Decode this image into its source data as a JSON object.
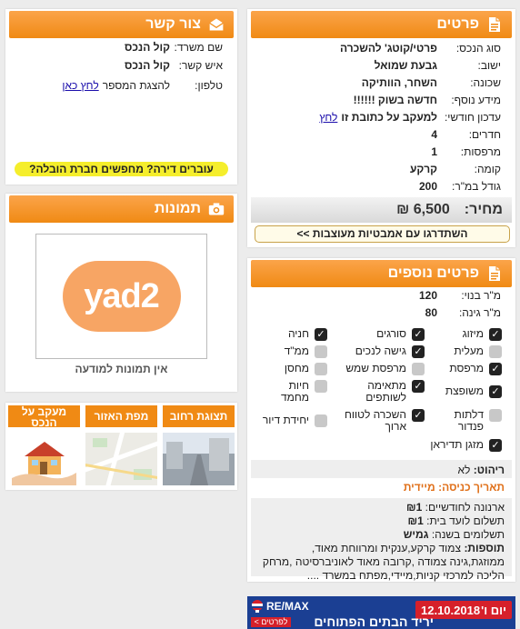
{
  "details": {
    "title": "פרטים",
    "rows": [
      {
        "label": "סוג הנכס:",
        "value": "פרטי/קוטג' להשכרה"
      },
      {
        "label": "ישוב:",
        "value": "גבעת שמואל"
      },
      {
        "label": "שכונה:",
        "value": "השחר, הוותיקה"
      },
      {
        "label": "מידע נוסף:",
        "value": "חדשה בשוק !!!!!!"
      },
      {
        "label": "עדכון חודשי:",
        "value": "למעקב על כתובת זו",
        "link": "לחץ"
      },
      {
        "label": "חדרים:",
        "value": "4"
      },
      {
        "label": "מרפסות:",
        "value": "1"
      },
      {
        "label": "קומה:",
        "value": "קרקע"
      },
      {
        "label": "גודל במ\"ר:",
        "value": "200"
      }
    ],
    "price_label": "מחיר:",
    "price_value": "6,500 ₪",
    "upgrade_button": "השתדרגו עם אמבטיות מעוצבות >>"
  },
  "more_details": {
    "title": "פרטים נוספים",
    "rows": [
      {
        "label": "מ\"ר בנוי:",
        "value": "120"
      },
      {
        "label": "מ\"ר גינה:",
        "value": "80"
      }
    ],
    "features": [
      {
        "label": "מיזוג",
        "checked": true
      },
      {
        "label": "סורגים",
        "checked": true
      },
      {
        "label": "חניה",
        "checked": true
      },
      {
        "label": "מעלית",
        "checked": false
      },
      {
        "label": "גישה לנכים",
        "checked": true
      },
      {
        "label": "ממ\"ד",
        "checked": false
      },
      {
        "label": "מרפסת",
        "checked": true
      },
      {
        "label": "מרפסת שמש",
        "checked": false
      },
      {
        "label": "מחסן",
        "checked": false
      },
      {
        "label": "משופצת",
        "checked": true
      },
      {
        "label": "מתאימה לשותפים",
        "checked": true
      },
      {
        "label": "חיות מחמד",
        "checked": false
      },
      {
        "label": "דלתות פנדור",
        "checked": false
      },
      {
        "label": "השכרה לטווח ארוך",
        "checked": true
      },
      {
        "label": "יחידת דיור",
        "checked": false
      },
      {
        "label": "מזגן תדיראן",
        "checked": true
      }
    ],
    "furniture_label": "ריהוט:",
    "furniture_value": "לא",
    "entry_label": "תאריך כניסה:",
    "entry_value": "מיידית",
    "arnona_label": "ארנונה לחודשיים:",
    "arnona_value": "₪1",
    "vaad_label": "תשלום לועד בית:",
    "vaad_value": "₪1",
    "payments_label": "תשלומים בשנה:",
    "payments_value": "גמיש",
    "additions_label": "תוספות:",
    "additions_text": "צמוד קרקע,ענקית ומרווחת מאוד, ממוזגת,גינה צמודה ,קרובה מאוד לאוניברסיטה ,מרחק הליכה למרכזי קניות,מיידי,מפתח במשרד ...."
  },
  "contact": {
    "title": "צור קשר",
    "office_label": "שם משרד:",
    "office_value": "קול הנכס",
    "person_label": "איש קשר:",
    "person_value": "קול הנכס",
    "phone_label": "טלפון:",
    "phone_text": "להצגת המספר",
    "phone_link": "לחץ כאן",
    "moving_banner": "עוברים דירה? מחפשים חברת הובלה?"
  },
  "images": {
    "title": "תמונות",
    "logo_text": "yad2",
    "no_images": "אין תמונות למודעה"
  },
  "tabs": [
    {
      "label": "תצוגת רחוב"
    },
    {
      "label": "מפת האזור"
    },
    {
      "label": "מעקב על הנכס"
    }
  ],
  "ad": {
    "brand": "RE/MAX",
    "cta": "לפרטים >",
    "headline": "יריד הבתים הפתוחים",
    "day": "יום ו'",
    "date": "12.10.2018"
  },
  "colors": {
    "accent": "#f7931e",
    "banner": "#f5ee2c",
    "remax_blue": "#1b3f93",
    "remax_red": "#d6202a"
  }
}
